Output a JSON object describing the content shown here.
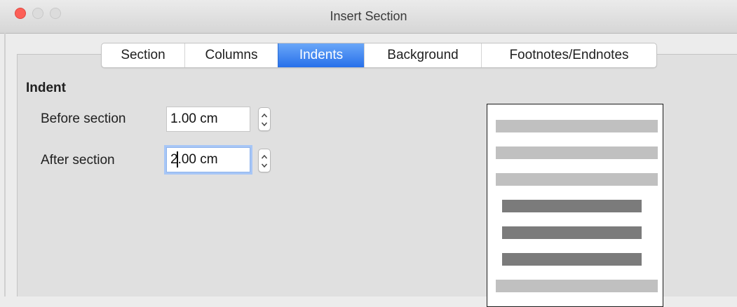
{
  "window": {
    "title": "Insert Section"
  },
  "tabs": [
    {
      "label": "Section",
      "active": false
    },
    {
      "label": "Columns",
      "active": false
    },
    {
      "label": "Indents",
      "active": true
    },
    {
      "label": "Background",
      "active": false
    },
    {
      "label": "Footnotes/Endnotes",
      "active": false
    }
  ],
  "indent": {
    "heading": "Indent",
    "before_label": "Before section",
    "before_value": "1.00 cm",
    "after_label": "After section",
    "after_value": "2.00 cm"
  },
  "preview": {
    "description_lines": [
      "section-text",
      "section-text",
      "section-text",
      "indented",
      "indented",
      "indented",
      "section-text"
    ]
  },
  "colors": {
    "active_tab": "#2770ea",
    "close_button": "#fc5f57",
    "focus_ring": "#a7c6f6"
  }
}
